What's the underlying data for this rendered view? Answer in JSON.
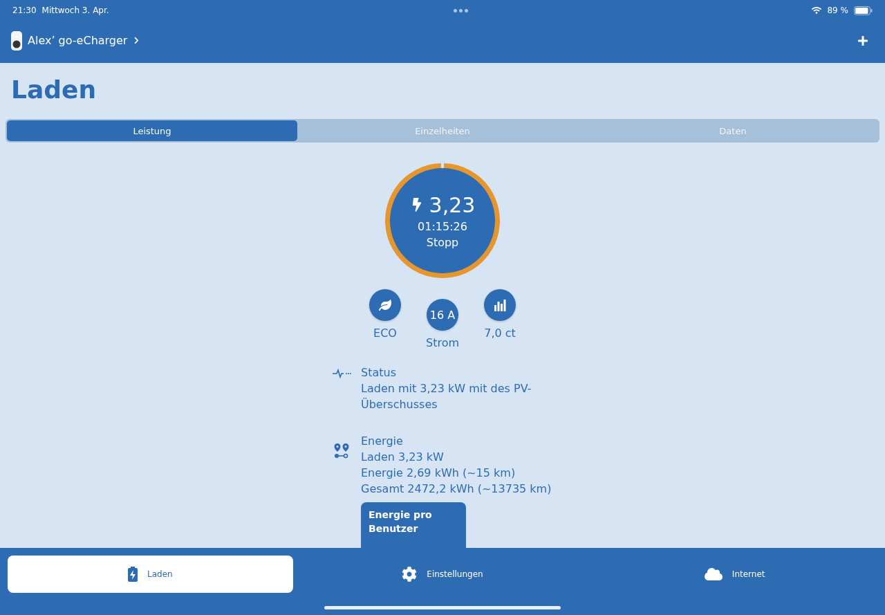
{
  "status_bar": {
    "time": "21:30",
    "date": "Mittwoch 3. Apr.",
    "battery": "89 %"
  },
  "header": {
    "device": "Alex’ go-eCharger"
  },
  "title": "Laden",
  "tabs": [
    {
      "label": "Leistung",
      "selected": true
    },
    {
      "label": "Einzelheiten",
      "selected": false
    },
    {
      "label": "Daten",
      "selected": false
    }
  ],
  "gauge": {
    "power": "3,23",
    "duration": "01:15:26",
    "action": "Stopp"
  },
  "controls": [
    {
      "kind": "eco",
      "label": "ECO"
    },
    {
      "kind": "current",
      "value": "16 A",
      "label": "Strom"
    },
    {
      "kind": "price",
      "label": "7,0 ct"
    }
  ],
  "sections": [
    {
      "kind": "status",
      "title": "Status",
      "lines": [
        "Laden mit 3,23 kW mit des PV-Überschusses"
      ]
    },
    {
      "kind": "energy",
      "title": "Energie",
      "lines": [
        "Laden 3,23 kW",
        "Energie 2,69 kWh (~15 km)",
        "Gesamt 2472,2 kWh (~13735 km)"
      ]
    }
  ],
  "card_button": "Energie pro Benutzer",
  "bottom_tabs": [
    {
      "kind": "charge",
      "label": "Laden",
      "selected": true
    },
    {
      "kind": "settings",
      "label": "Einstellungen",
      "selected": false
    },
    {
      "kind": "cloud",
      "label": "Internet",
      "selected": false
    }
  ]
}
